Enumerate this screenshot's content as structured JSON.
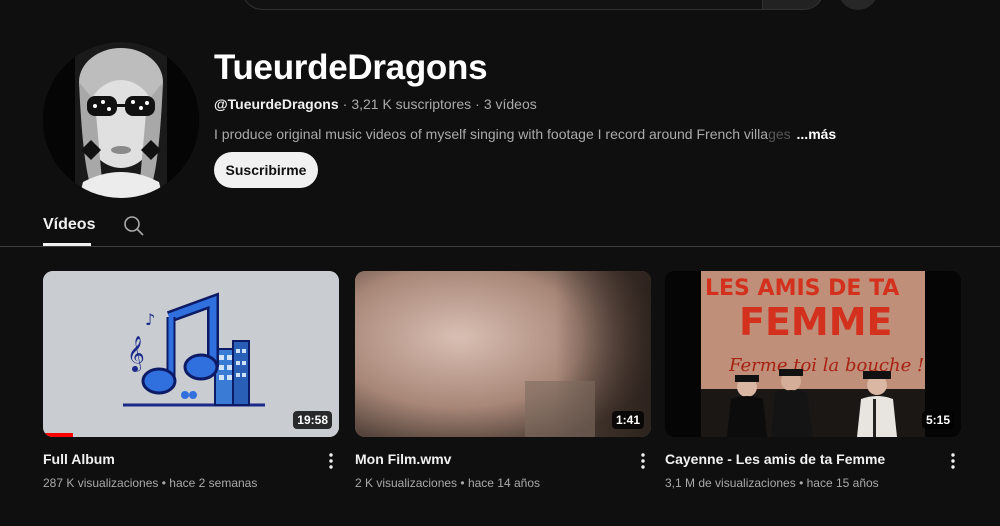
{
  "channel": {
    "name": "TueurdeDragons",
    "handle": "@TueurdeDragons",
    "subscribers": "3,21 K suscriptores",
    "videos_count": "3 vídeos",
    "description": "I produce original music videos of myself singing with footage I record around French villa",
    "description_fade": "ges",
    "more_label": "...más",
    "subscribe_label": "Suscribirme"
  },
  "tabs": {
    "videos_label": "Vídeos"
  },
  "videos": [
    {
      "title": "Full Album",
      "views": "287 K visualizaciones",
      "age": "hace 2 semanas",
      "duration": "19:58",
      "watched_fraction": 0.1
    },
    {
      "title": "Mon Film.wmv",
      "views": "2 K visualizaciones",
      "age": "hace 14 años",
      "duration": "1:41"
    },
    {
      "title": "Cayenne - Les amis de ta Femme",
      "views": "3,1 M de visualizaciones",
      "age": "hace 15 años",
      "duration": "5:15",
      "thumb_text_top": "LES AMIS DE TA",
      "thumb_text_mid": "FEMME",
      "thumb_text_script": "Ferme toi la bouche !"
    }
  ],
  "icons": {
    "search": "search-icon",
    "kebab": "more-vert-icon"
  },
  "colors": {
    "background": "#0f0f0f",
    "accent_red": "#ff0000",
    "subscribe_bg": "#f1f1f1"
  }
}
